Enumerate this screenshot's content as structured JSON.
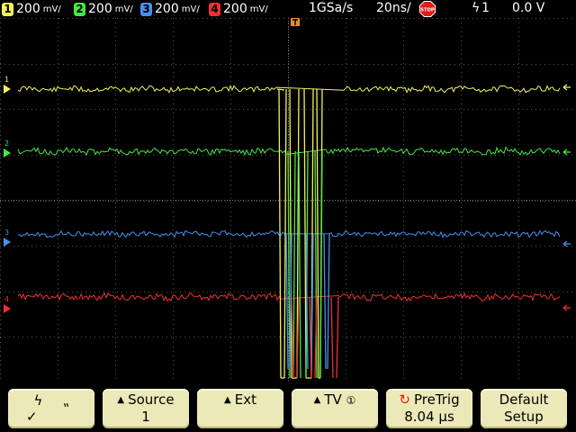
{
  "status": {
    "channels": [
      {
        "num": "1",
        "scale": "200",
        "unit": "mV/",
        "color": "#f2f25a"
      },
      {
        "num": "2",
        "scale": "200",
        "unit": "mV/",
        "color": "#46e646"
      },
      {
        "num": "3",
        "scale": "200",
        "unit": "mV/",
        "color": "#4a8ff0"
      },
      {
        "num": "4",
        "scale": "200",
        "unit": "mV/",
        "color": "#f03030"
      }
    ],
    "sample_rate": "1GSa/s",
    "timebase": "20ns/",
    "run_state": "STOP",
    "trigger_source": "1",
    "trigger_level": "0.0 V"
  },
  "softkeys": {
    "slope_rising": "ϟ",
    "slope_falling": "⹂",
    "slope_check": "✓",
    "source_label": "Source",
    "source_value": "1",
    "ext_label": "Ext",
    "tv_label": "TV",
    "tv_icon": "①",
    "pretrig_label": "PreTrig",
    "pretrig_value": "8.04 µs",
    "default_label": "Default",
    "default_label2": "Setup"
  },
  "colors": {
    "ch1": "#f2f25a",
    "ch2": "#46e646",
    "ch3": "#4a8ff0",
    "ch4": "#f03030",
    "trigger": "#f58a1f",
    "grid": "#6e6e6e",
    "softkey_bg": "#ece9b8"
  },
  "icons": {
    "stop": "stop-sign-icon",
    "trigger_position": "trigger-position-icon",
    "pretrig": "rotate-icon"
  }
}
